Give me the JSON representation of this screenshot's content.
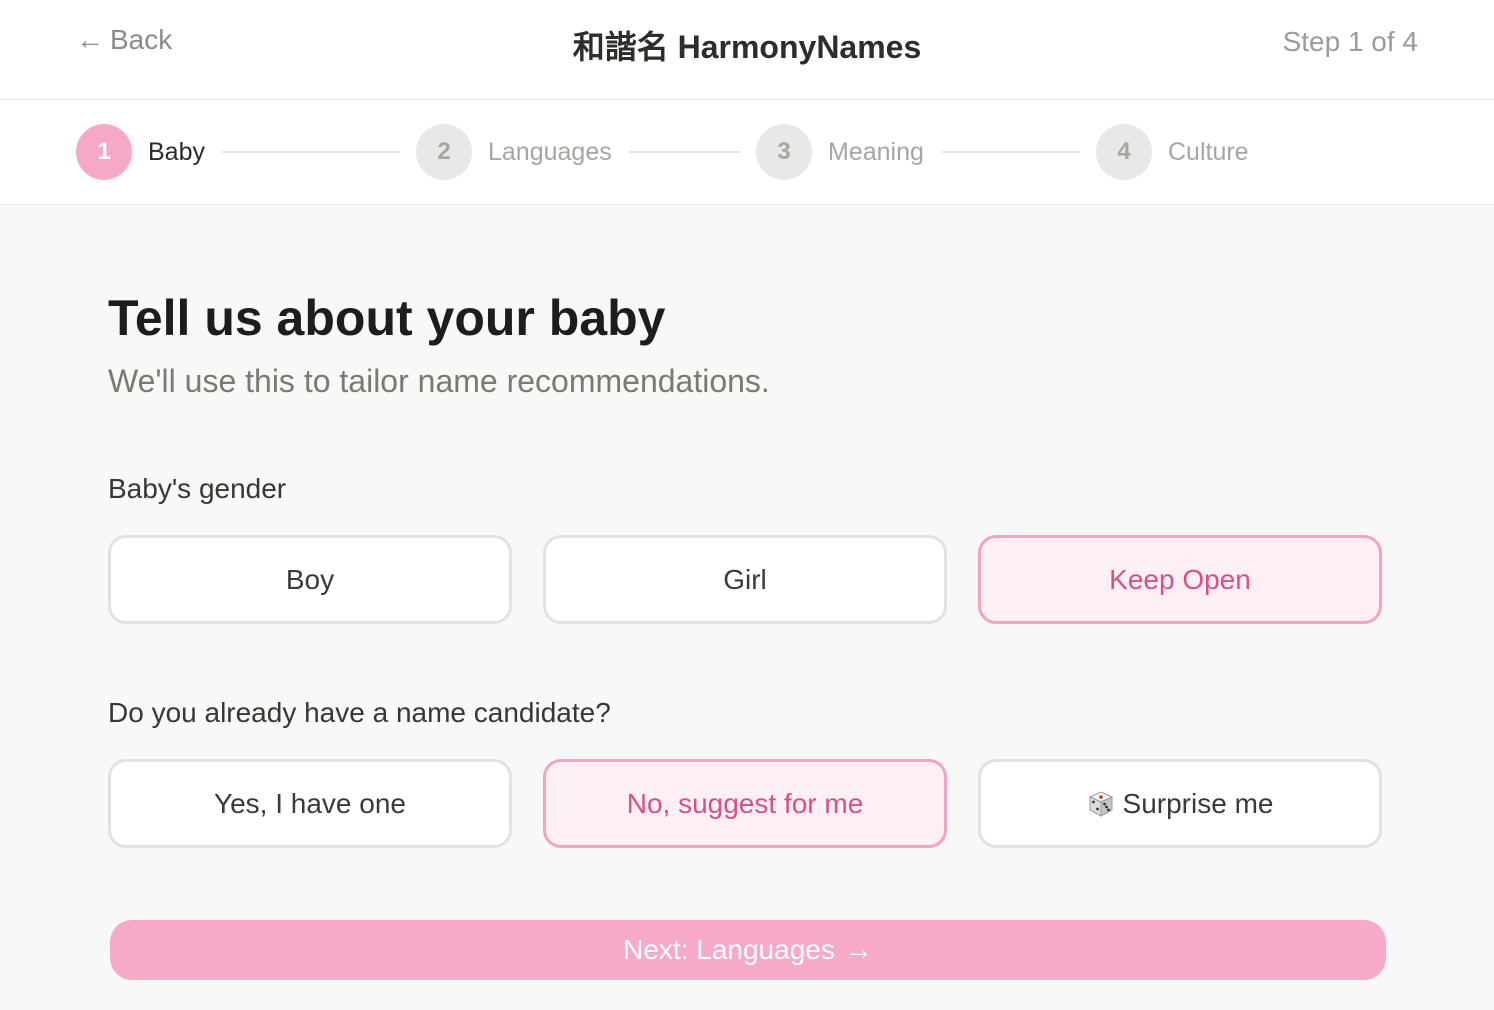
{
  "header": {
    "back_label": "Back",
    "back_icon": "arrow-left-icon",
    "app_title": "和諧名 HarmonyNames",
    "step_indicator": "Step 1 of 4"
  },
  "stepper": {
    "steps": [
      {
        "number": "1",
        "label": "Baby",
        "state": "active"
      },
      {
        "number": "2",
        "label": "Languages",
        "state": "upcoming"
      },
      {
        "number": "3",
        "label": "Meaning",
        "state": "upcoming"
      },
      {
        "number": "4",
        "label": "Culture",
        "state": "upcoming"
      }
    ]
  },
  "main": {
    "title": "Tell us about your baby",
    "subtitle": "We'll use this to tailor name recommendations."
  },
  "gender": {
    "label": "Baby's gender",
    "options": [
      {
        "label": "Boy",
        "selected": false
      },
      {
        "label": "Girl",
        "selected": false
      },
      {
        "label": "Keep Open",
        "selected": true
      }
    ]
  },
  "candidate": {
    "label": "Do you already have a name candidate?",
    "options": [
      {
        "label": "Yes, I have one",
        "selected": false
      },
      {
        "label": "No, suggest for me",
        "selected": true
      },
      {
        "label": "Surprise me",
        "selected": false,
        "icon": "dice-icon"
      }
    ]
  },
  "next_button": {
    "label": "Next: Languages",
    "icon": "arrow-right-icon"
  },
  "colors": {
    "accent": "#f7a9c8",
    "accent_text": "#d94f86",
    "selected_bg": "#fdf0f5",
    "page_bg": "#f8f8f7"
  }
}
